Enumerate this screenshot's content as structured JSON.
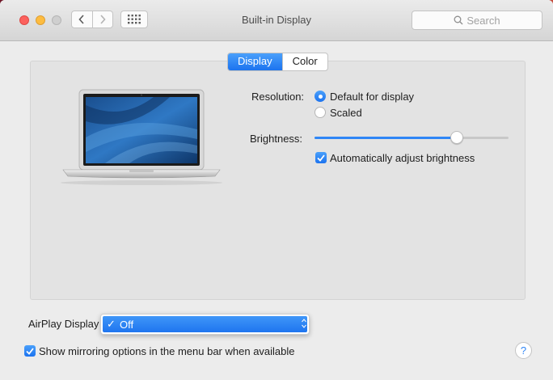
{
  "window": {
    "title": "Built-in Display"
  },
  "search": {
    "placeholder": "Search"
  },
  "tabs": [
    {
      "label": "Display",
      "active": true
    },
    {
      "label": "Color",
      "active": false
    }
  ],
  "resolution": {
    "label": "Resolution:",
    "options": [
      {
        "label": "Default for display",
        "selected": true
      },
      {
        "label": "Scaled",
        "selected": false
      }
    ]
  },
  "brightness": {
    "label": "Brightness:",
    "value_percent": 75,
    "auto_label": "Automatically adjust brightness",
    "auto_checked": true
  },
  "airplay": {
    "label": "AirPlay Display",
    "selected": "Off",
    "check_glyph": "✓"
  },
  "mirroring": {
    "label": "Show mirroring options in the menu bar when available",
    "checked": true
  },
  "help": {
    "glyph": "?"
  },
  "colors": {
    "accent": "#1c73ef",
    "close": "#fc615d",
    "minimize": "#fdbc40",
    "zoom_disabled": "#cfcfcf"
  }
}
